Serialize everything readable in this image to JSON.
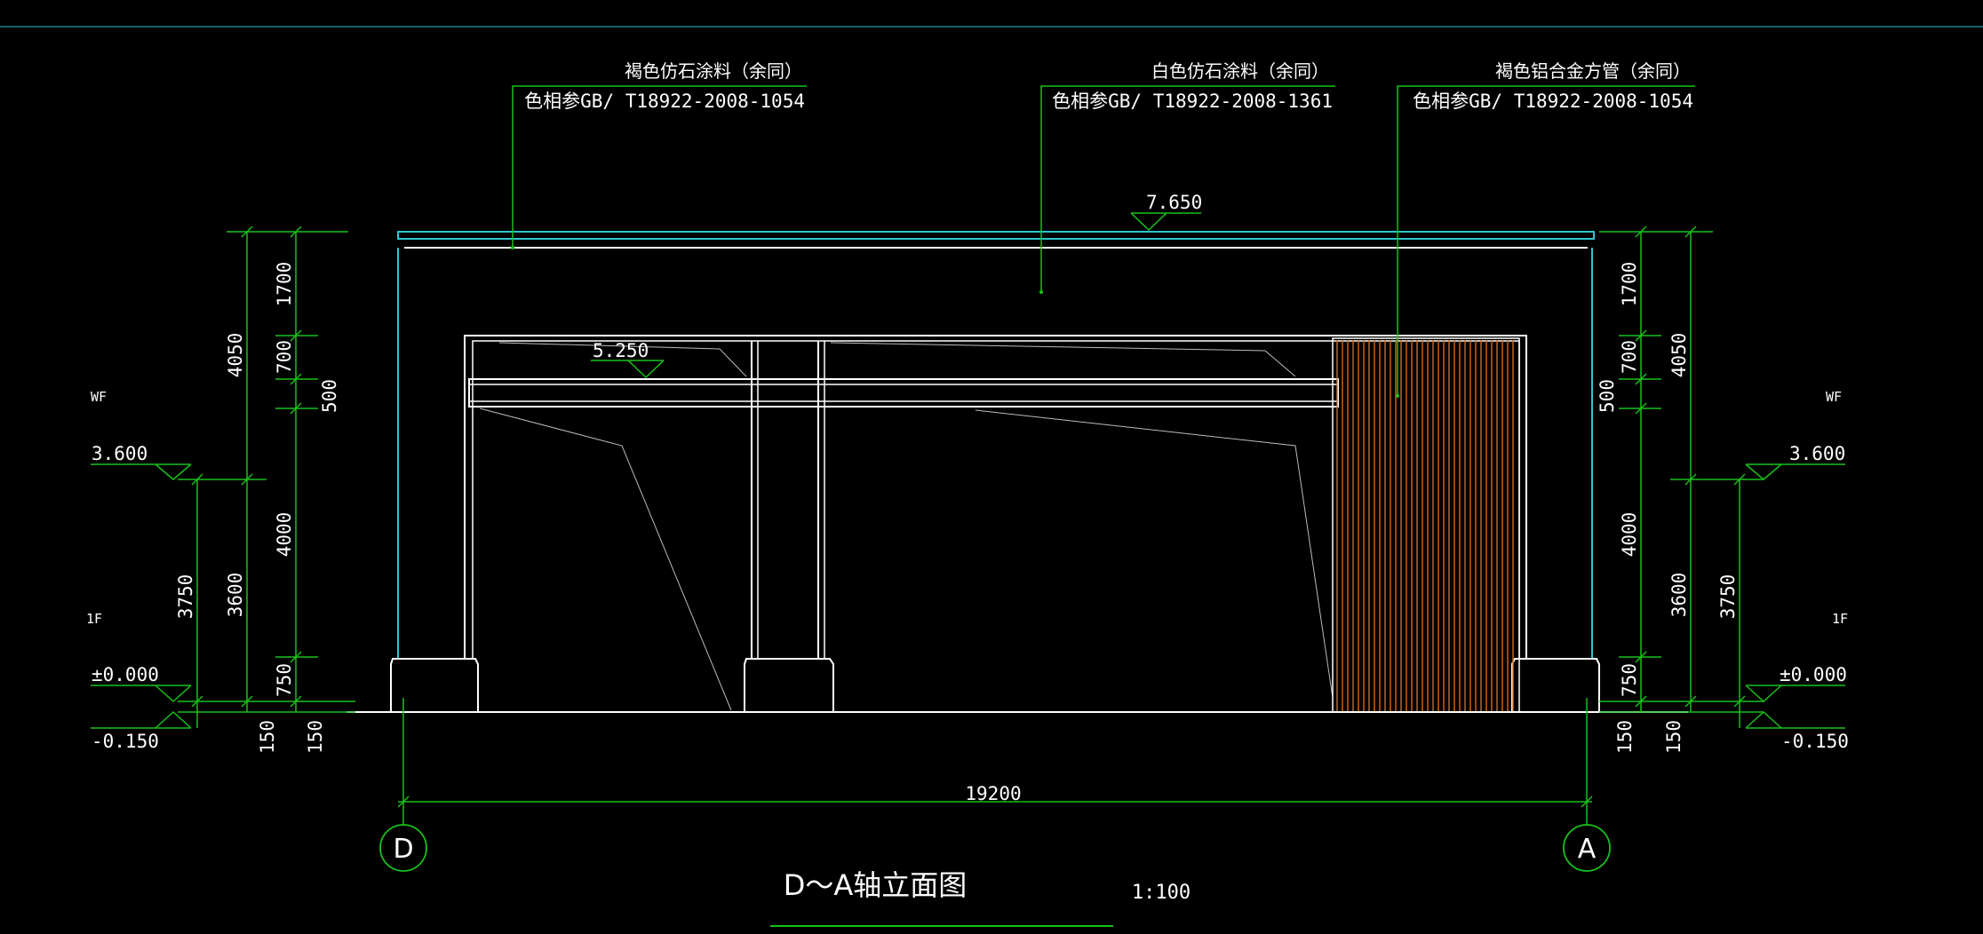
{
  "colors": {
    "background": "#000000",
    "outline": "#ffffff",
    "dimension": "#19c119",
    "cyan": "#2ec6d0",
    "wood": "#d2691e"
  },
  "callouts": [
    {
      "line1": "褐色仿石涂料（余同）",
      "line2": "色相参GB/ T18922-2008-1054"
    },
    {
      "line1": "白色仿石涂料（余同）",
      "line2": "色相参GB/ T18922-2008-1361"
    },
    {
      "line1": "褐色铝合金方管（余同）",
      "line2": "色相参GB/ T18922-2008-1054"
    }
  ],
  "elevations": {
    "top": "7.650",
    "beam": "5.250",
    "left_wf": "3.600",
    "left_ground": "±0.000",
    "left_base": "-0.150",
    "right_wf": "3.600",
    "right_ground": "±0.000",
    "right_base": "-0.150"
  },
  "floors": {
    "wf_left": "WF",
    "f1_left": "1F",
    "wf_right": "WF",
    "f1_right": "1F"
  },
  "dims_left": {
    "outer_total": "4050",
    "outer_lower": "3750",
    "d1700": "1700",
    "d700": "700",
    "d500": "500",
    "d4000": "4000",
    "d750": "750",
    "d3600": "3600",
    "d150a": "150",
    "d150b": "150"
  },
  "dims_right": {
    "d1700": "1700",
    "d700": "700",
    "d500": "500",
    "d4000": "4000",
    "d750": "750",
    "outer_total": "4050",
    "d3600": "3600",
    "outer_lower": "3750",
    "d150a": "150",
    "d150b": "150"
  },
  "horizontal_dim": "19200",
  "axes": {
    "left": "D",
    "right": "A"
  },
  "title": "D～A轴立面图",
  "scale": "1:100"
}
